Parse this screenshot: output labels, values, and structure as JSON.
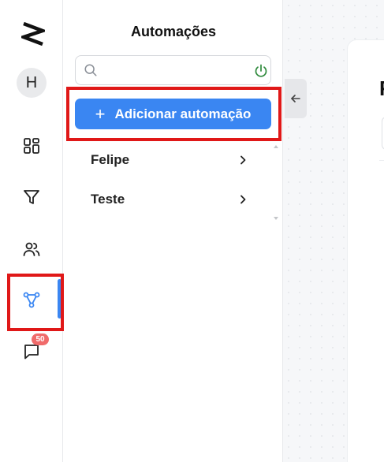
{
  "sidebar": {
    "avatar_initial": "H",
    "notification_count": "50",
    "active_item": "automations",
    "items": [
      {
        "icon": "dashboard-icon"
      },
      {
        "icon": "filter-icon"
      },
      {
        "icon": "users-icon"
      },
      {
        "icon": "workflow-icon"
      },
      {
        "icon": "chat-icon"
      }
    ],
    "accent_color": "#3a86f2"
  },
  "panel": {
    "title": "Automações",
    "search": {
      "value": "",
      "placeholder": ""
    },
    "add_button_label": "Adicionar automação",
    "items": [
      {
        "label": "Felipe"
      },
      {
        "label": "Teste"
      }
    ]
  },
  "main": {
    "title_partial": "F"
  },
  "annotations": {
    "highlight_color": "#e01818"
  }
}
